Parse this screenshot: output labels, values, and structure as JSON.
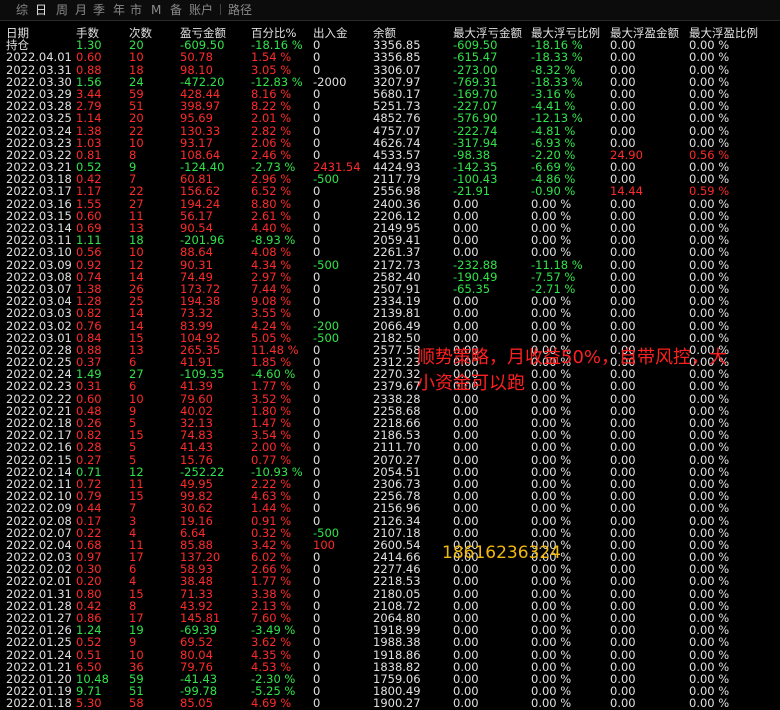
{
  "tabs": [
    "综",
    "日",
    "周",
    "月",
    "季",
    "年",
    "市",
    "M",
    "备",
    "账户",
    "路径"
  ],
  "active_tab": "日",
  "headers": [
    "日期",
    "手数",
    "次数",
    "盈亏金额",
    "百分比%",
    "出入金",
    "余额",
    "最大浮亏金额",
    "最大浮亏比例",
    "最大浮盈金额",
    "最大浮盈比例"
  ],
  "colors": {
    "profit": "#ff2b2b",
    "loss": "#31e44a",
    "neutral": "#e0e0e0",
    "overlay": "#ff1f1f",
    "phone": "#f0b90b"
  },
  "overlay_text": {
    "line1": "顺势策略，月收益50%，自带风控，大",
    "line2": "小资金可以跑",
    "phone": "18616236324"
  },
  "rows": [
    {
      "c": [
        "持仓",
        "1.30",
        "20",
        "-609.50",
        "-18.16 %",
        "0",
        "3356.85",
        "-609.50",
        "-18.16 %",
        "0.00",
        "0.00 %"
      ],
      "k": "g"
    },
    {
      "c": [
        "2022.04.01",
        "0.60",
        "10",
        "50.78",
        "1.54 %",
        "0",
        "3356.85",
        "-615.47",
        "-18.33 %",
        "0.00",
        "0.00 %"
      ],
      "k": "r"
    },
    {
      "c": [
        "2022.03.31",
        "0.88",
        "18",
        "98.10",
        "3.05 %",
        "0",
        "3306.07",
        "-273.00",
        "-8.32 %",
        "0.00",
        "0.00 %"
      ],
      "k": "r"
    },
    {
      "c": [
        "2022.03.30",
        "1.56",
        "24",
        "-472.20",
        "-12.83 %",
        "-2000",
        "3207.97",
        "-769.31",
        "-18.33 %",
        "0.00",
        "0.00 %"
      ],
      "k": "g"
    },
    {
      "c": [
        "2022.03.29",
        "3.44",
        "59",
        "428.44",
        "8.16 %",
        "0",
        "5680.17",
        "-169.70",
        "-3.16 %",
        "0.00",
        "0.00 %"
      ],
      "k": "r"
    },
    {
      "c": [
        "2022.03.28",
        "2.79",
        "51",
        "398.97",
        "8.22 %",
        "0",
        "5251.73",
        "-227.07",
        "-4.41 %",
        "0.00",
        "0.00 %"
      ],
      "k": "r"
    },
    {
      "c": [
        "2022.03.25",
        "1.14",
        "20",
        "95.69",
        "2.01 %",
        "0",
        "4852.76",
        "-576.90",
        "-12.13 %",
        "0.00",
        "0.00 %"
      ],
      "k": "r"
    },
    {
      "c": [
        "2022.03.24",
        "1.38",
        "22",
        "130.33",
        "2.82 %",
        "0",
        "4757.07",
        "-222.74",
        "-4.81 %",
        "0.00",
        "0.00 %"
      ],
      "k": "r"
    },
    {
      "c": [
        "2022.03.23",
        "1.03",
        "10",
        "93.17",
        "2.06 %",
        "0",
        "4626.74",
        "-317.94",
        "-6.93 %",
        "0.00",
        "0.00 %"
      ],
      "k": "r"
    },
    {
      "c": [
        "2022.03.22",
        "0.81",
        "8",
        "108.64",
        "2.46 %",
        "0",
        "4533.57",
        "-98.38",
        "-2.20 %",
        "24.90",
        "0.56 %"
      ],
      "k": "r",
      "pk": "r"
    },
    {
      "c": [
        "2022.03.21",
        "0.52",
        "9",
        "-124.40",
        "-2.73 %",
        "2431.54",
        "4424.93",
        "-142.35",
        "-6.69 %",
        "0.00",
        "0.00 %"
      ],
      "k": "g",
      "ik": "r"
    },
    {
      "c": [
        "2022.03.18",
        "0.42",
        "7",
        "60.81",
        "2.96 %",
        "-500",
        "2117.79",
        "-100.43",
        "-4.86 %",
        "0.00",
        "0.00 %"
      ],
      "k": "r",
      "ik": "g"
    },
    {
      "c": [
        "2022.03.17",
        "1.17",
        "22",
        "156.62",
        "6.52 %",
        "0",
        "2556.98",
        "-21.91",
        "-0.90 %",
        "14.44",
        "0.59 %"
      ],
      "k": "r",
      "pk": "r"
    },
    {
      "c": [
        "2022.03.16",
        "1.55",
        "27",
        "194.24",
        "8.80 %",
        "0",
        "2400.36",
        "0.00",
        "0.00 %",
        "0.00",
        "0.00 %"
      ],
      "k": "r"
    },
    {
      "c": [
        "2022.03.15",
        "0.60",
        "11",
        "56.17",
        "2.61 %",
        "0",
        "2206.12",
        "0.00",
        "0.00 %",
        "0.00",
        "0.00 %"
      ],
      "k": "r"
    },
    {
      "c": [
        "2022.03.14",
        "0.69",
        "13",
        "90.54",
        "4.40 %",
        "0",
        "2149.95",
        "0.00",
        "0.00 %",
        "0.00",
        "0.00 %"
      ],
      "k": "r"
    },
    {
      "c": [
        "2022.03.11",
        "1.11",
        "18",
        "-201.96",
        "-8.93 %",
        "0",
        "2059.41",
        "0.00",
        "0.00 %",
        "0.00",
        "0.00 %"
      ],
      "k": "g"
    },
    {
      "c": [
        "2022.03.10",
        "0.56",
        "10",
        "88.64",
        "4.08 %",
        "0",
        "2261.37",
        "0.00",
        "0.00 %",
        "0.00",
        "0.00 %"
      ],
      "k": "r"
    },
    {
      "c": [
        "2022.03.09",
        "0.92",
        "12",
        "90.31",
        "4.34 %",
        "-500",
        "2172.73",
        "-232.88",
        "-11.18 %",
        "0.00",
        "0.00 %"
      ],
      "k": "r",
      "ik": "g"
    },
    {
      "c": [
        "2022.03.08",
        "0.74",
        "14",
        "74.49",
        "2.97 %",
        "0",
        "2582.40",
        "-190.49",
        "-7.57 %",
        "0.00",
        "0.00 %"
      ],
      "k": "r"
    },
    {
      "c": [
        "2022.03.07",
        "1.38",
        "26",
        "173.72",
        "7.44 %",
        "0",
        "2507.91",
        "-65.35",
        "-2.71 %",
        "0.00",
        "0.00 %"
      ],
      "k": "r"
    },
    {
      "c": [
        "2022.03.04",
        "1.28",
        "25",
        "194.38",
        "9.08 %",
        "0",
        "2334.19",
        "0.00",
        "0.00 %",
        "0.00",
        "0.00 %"
      ],
      "k": "r"
    },
    {
      "c": [
        "2022.03.03",
        "0.82",
        "14",
        "73.32",
        "3.55 %",
        "0",
        "2139.81",
        "0.00",
        "0.00 %",
        "0.00",
        "0.00 %"
      ],
      "k": "r"
    },
    {
      "c": [
        "2022.03.02",
        "0.76",
        "14",
        "83.99",
        "4.24 %",
        "-200",
        "2066.49",
        "0.00",
        "0.00 %",
        "0.00",
        "0.00 %"
      ],
      "k": "r",
      "ik": "g"
    },
    {
      "c": [
        "2022.03.01",
        "0.84",
        "15",
        "104.92",
        "5.05 %",
        "-500",
        "2182.50",
        "0.00",
        "0.00 %",
        "0.00",
        "0.00 %"
      ],
      "k": "r",
      "ik": "g"
    },
    {
      "c": [
        "2022.02.28",
        "0.88",
        "13",
        "265.35",
        "11.48 %",
        "0",
        "2577.58",
        "0.00",
        "0.00 %",
        "0.00",
        "0.00 %"
      ],
      "k": "r"
    },
    {
      "c": [
        "2022.02.25",
        "0.37",
        "6",
        "41.91",
        "1.85 %",
        "0",
        "2312.23",
        "0.00",
        "0.00 %",
        "0.00",
        "0.00 %"
      ],
      "k": "r"
    },
    {
      "c": [
        "2022.02.24",
        "1.49",
        "27",
        "-109.35",
        "-4.60 %",
        "0",
        "2270.32",
        "0.00",
        "0.00 %",
        "0.00",
        "0.00 %"
      ],
      "k": "g"
    },
    {
      "c": [
        "2022.02.23",
        "0.31",
        "6",
        "41.39",
        "1.77 %",
        "0",
        "2379.67",
        "0.00",
        "0.00 %",
        "0.00",
        "0.00 %"
      ],
      "k": "r"
    },
    {
      "c": [
        "2022.02.22",
        "0.60",
        "10",
        "79.60",
        "3.52 %",
        "0",
        "2338.28",
        "0.00",
        "0.00 %",
        "0.00",
        "0.00 %"
      ],
      "k": "r"
    },
    {
      "c": [
        "2022.02.21",
        "0.48",
        "9",
        "40.02",
        "1.80 %",
        "0",
        "2258.68",
        "0.00",
        "0.00 %",
        "0.00",
        "0.00 %"
      ],
      "k": "r"
    },
    {
      "c": [
        "2022.02.18",
        "0.26",
        "5",
        "32.13",
        "1.47 %",
        "0",
        "2218.66",
        "0.00",
        "0.00 %",
        "0.00",
        "0.00 %"
      ],
      "k": "r"
    },
    {
      "c": [
        "2022.02.17",
        "0.82",
        "15",
        "74.83",
        "3.54 %",
        "0",
        "2186.53",
        "0.00",
        "0.00 %",
        "0.00",
        "0.00 %"
      ],
      "k": "r"
    },
    {
      "c": [
        "2022.02.16",
        "0.28",
        "5",
        "41.43",
        "2.00 %",
        "0",
        "2111.70",
        "0.00",
        "0.00 %",
        "0.00",
        "0.00 %"
      ],
      "k": "r"
    },
    {
      "c": [
        "2022.02.15",
        "0.27",
        "5",
        "15.76",
        "0.77 %",
        "0",
        "2070.27",
        "0.00",
        "0.00 %",
        "0.00",
        "0.00 %"
      ],
      "k": "r"
    },
    {
      "c": [
        "2022.02.14",
        "0.71",
        "12",
        "-252.22",
        "-10.93 %",
        "0",
        "2054.51",
        "0.00",
        "0.00 %",
        "0.00",
        "0.00 %"
      ],
      "k": "g"
    },
    {
      "c": [
        "2022.02.11",
        "0.72",
        "11",
        "49.95",
        "2.22 %",
        "0",
        "2306.73",
        "0.00",
        "0.00 %",
        "0.00",
        "0.00 %"
      ],
      "k": "r"
    },
    {
      "c": [
        "2022.02.10",
        "0.79",
        "15",
        "99.82",
        "4.63 %",
        "0",
        "2256.78",
        "0.00",
        "0.00 %",
        "0.00",
        "0.00 %"
      ],
      "k": "r"
    },
    {
      "c": [
        "2022.02.09",
        "0.44",
        "7",
        "30.62",
        "1.44 %",
        "0",
        "2156.96",
        "0.00",
        "0.00 %",
        "0.00",
        "0.00 %"
      ],
      "k": "r"
    },
    {
      "c": [
        "2022.02.08",
        "0.17",
        "3",
        "19.16",
        "0.91 %",
        "0",
        "2126.34",
        "0.00",
        "0.00 %",
        "0.00",
        "0.00 %"
      ],
      "k": "r"
    },
    {
      "c": [
        "2022.02.07",
        "0.22",
        "4",
        "6.64",
        "0.32 %",
        "-500",
        "2107.18",
        "0.00",
        "0.00 %",
        "0.00",
        "0.00 %"
      ],
      "k": "r",
      "ik": "g"
    },
    {
      "c": [
        "2022.02.04",
        "0.68",
        "11",
        "85.88",
        "3.42 %",
        "100",
        "2600.54",
        "0.00",
        "0.00 %",
        "0.00",
        "0.00 %"
      ],
      "k": "r",
      "ik": "r"
    },
    {
      "c": [
        "2022.02.03",
        "0.97",
        "17",
        "137.20",
        "6.02 %",
        "0",
        "2414.66",
        "0.00",
        "0.00 %",
        "0.00",
        "0.00 %"
      ],
      "k": "r"
    },
    {
      "c": [
        "2022.02.02",
        "0.30",
        "6",
        "58.93",
        "2.66 %",
        "0",
        "2277.46",
        "0.00",
        "0.00 %",
        "0.00",
        "0.00 %"
      ],
      "k": "r"
    },
    {
      "c": [
        "2022.02.01",
        "0.20",
        "4",
        "38.48",
        "1.77 %",
        "0",
        "2218.53",
        "0.00",
        "0.00 %",
        "0.00",
        "0.00 %"
      ],
      "k": "r"
    },
    {
      "c": [
        "2022.01.31",
        "0.80",
        "15",
        "71.33",
        "3.38 %",
        "0",
        "2180.05",
        "0.00",
        "0.00 %",
        "0.00",
        "0.00 %"
      ],
      "k": "r"
    },
    {
      "c": [
        "2022.01.28",
        "0.42",
        "8",
        "43.92",
        "2.13 %",
        "0",
        "2108.72",
        "0.00",
        "0.00 %",
        "0.00",
        "0.00 %"
      ],
      "k": "r"
    },
    {
      "c": [
        "2022.01.27",
        "0.86",
        "17",
        "145.81",
        "7.60 %",
        "0",
        "2064.80",
        "0.00",
        "0.00 %",
        "0.00",
        "0.00 %"
      ],
      "k": "r"
    },
    {
      "c": [
        "2022.01.26",
        "1.24",
        "19",
        "-69.39",
        "-3.49 %",
        "0",
        "1918.99",
        "0.00",
        "0.00 %",
        "0.00",
        "0.00 %"
      ],
      "k": "g"
    },
    {
      "c": [
        "2022.01.25",
        "0.52",
        "9",
        "69.52",
        "3.62 %",
        "0",
        "1988.38",
        "0.00",
        "0.00 %",
        "0.00",
        "0.00 %"
      ],
      "k": "r"
    },
    {
      "c": [
        "2022.01.24",
        "0.51",
        "10",
        "80.04",
        "4.35 %",
        "0",
        "1918.86",
        "0.00",
        "0.00 %",
        "0.00",
        "0.00 %"
      ],
      "k": "r"
    },
    {
      "c": [
        "2022.01.21",
        "6.50",
        "36",
        "79.76",
        "4.53 %",
        "0",
        "1838.82",
        "0.00",
        "0.00 %",
        "0.00",
        "0.00 %"
      ],
      "k": "r"
    },
    {
      "c": [
        "2022.01.20",
        "10.48",
        "59",
        "-41.43",
        "-2.30 %",
        "0",
        "1759.06",
        "0.00",
        "0.00 %",
        "0.00",
        "0.00 %"
      ],
      "k": "g"
    },
    {
      "c": [
        "2022.01.19",
        "9.71",
        "51",
        "-99.78",
        "-5.25 %",
        "0",
        "1800.49",
        "0.00",
        "0.00 %",
        "0.00",
        "0.00 %"
      ],
      "k": "g"
    },
    {
      "c": [
        "2022.01.18",
        "5.30",
        "58",
        "85.05",
        "4.69 %",
        "0",
        "1900.27",
        "0.00",
        "0.00 %",
        "0.00",
        "0.00 %"
      ],
      "k": "r"
    }
  ]
}
